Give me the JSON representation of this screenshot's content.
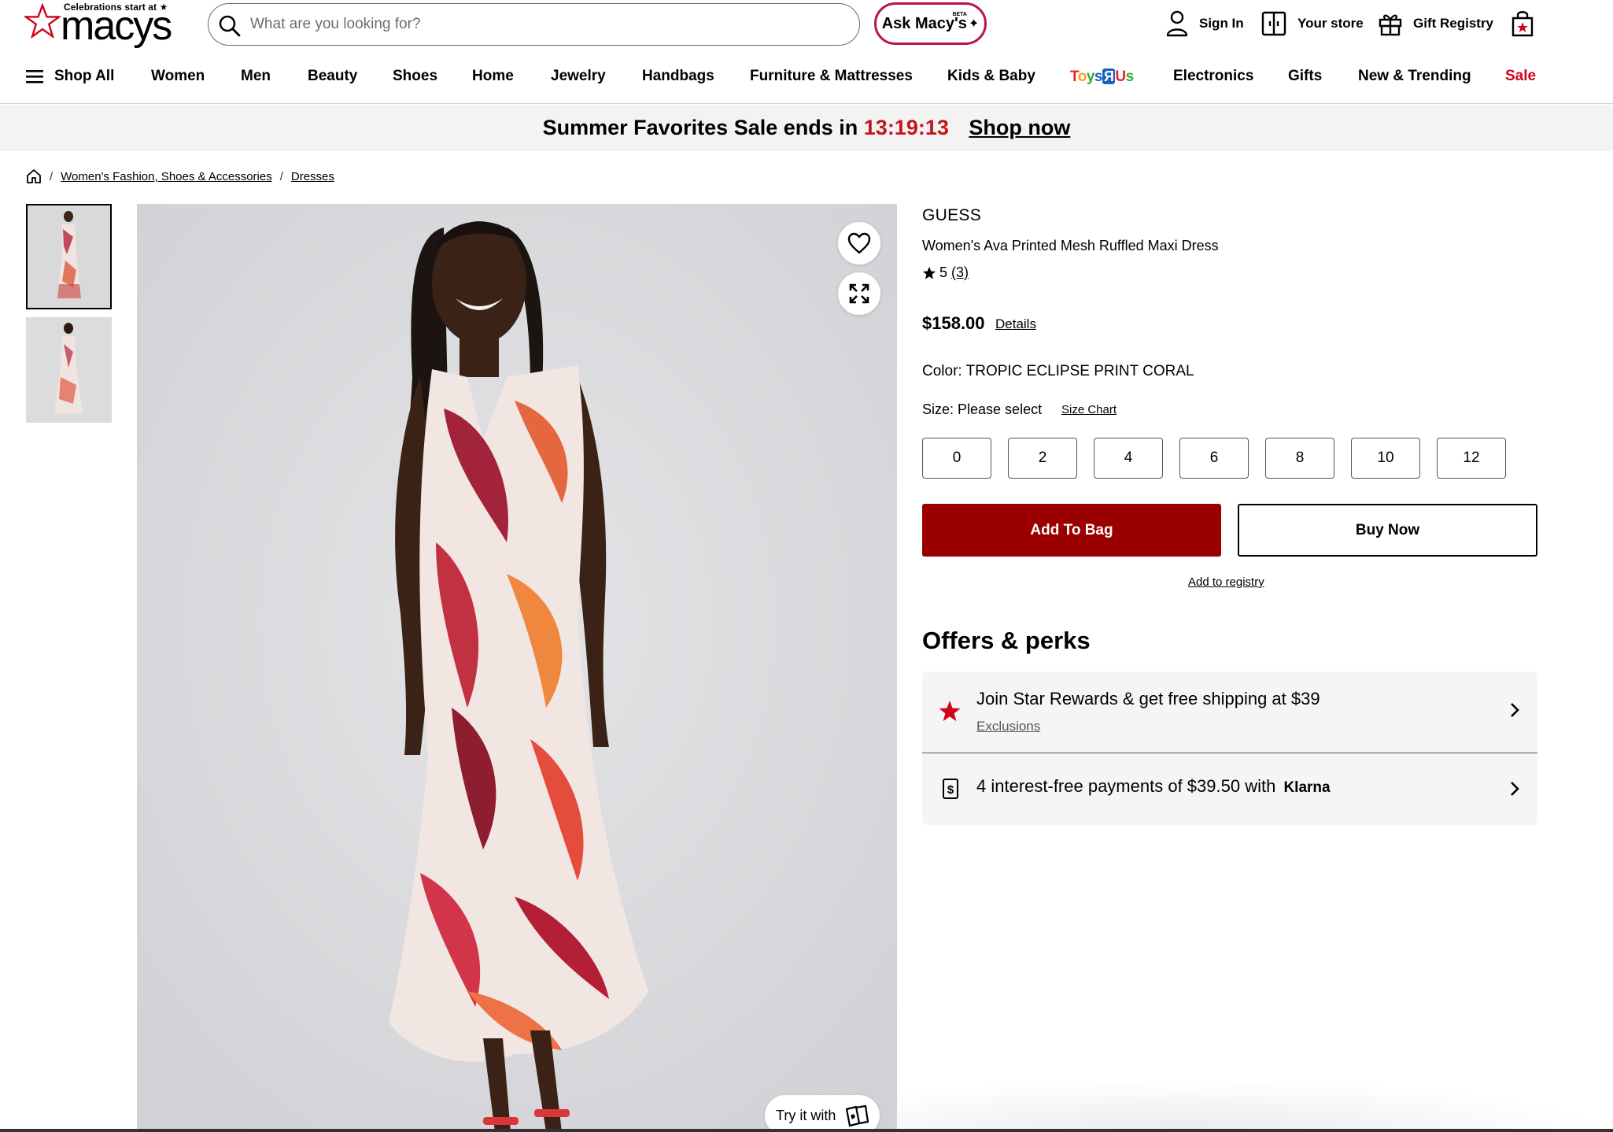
{
  "header": {
    "logo_tagline": "Celebrations start at ★",
    "logo_word": "macys",
    "search_placeholder": "What are you looking for?",
    "ask_label": "Ask Macy's",
    "ask_badge": "BETA",
    "sign_in": "Sign In",
    "your_store": "Your store",
    "gift_registry": "Gift Registry"
  },
  "nav": {
    "shop_all": "Shop All",
    "items": [
      "Women",
      "Men",
      "Beauty",
      "Shoes",
      "Home",
      "Jewelry",
      "Handbags",
      "Furniture & Mattresses",
      "Kids & Baby",
      "Toys R Us",
      "Electronics",
      "Gifts",
      "New & Trending",
      "Sale"
    ]
  },
  "promo": {
    "text": "Summer Favorites Sale ends in",
    "timer": "13:19:13",
    "link": "Shop now"
  },
  "breadcrumb": {
    "items": [
      "Women's Fashion, Shoes & Accessories",
      "Dresses"
    ]
  },
  "product": {
    "brand": "GUESS",
    "name": "Women's Ava Printed Mesh Ruffled Maxi Dress",
    "rating": "5",
    "review_count": "(3)",
    "price": "$158.00",
    "details_link": "Details",
    "color_label": "Color: TROPIC ECLIPSE PRINT CORAL",
    "size_label": "Size: Please select",
    "size_chart": "Size Chart",
    "sizes": [
      "0",
      "2",
      "4",
      "6",
      "8",
      "10",
      "12"
    ],
    "add_to_bag": "Add To Bag",
    "buy_now": "Buy Now",
    "add_to_registry": "Add to registry",
    "try_it_with": "Try it with"
  },
  "offers": {
    "heading": "Offers & perks",
    "star_rewards": "Join Star Rewards & get free shipping at $39",
    "exclusions": "Exclusions",
    "klarna": "4 interest-free payments of $39.50 with",
    "klarna_brand": "Klarna"
  },
  "colors": {
    "brand_red": "#c4141b",
    "add_bag_bg": "#9b0000",
    "ask_border": "#b7154a"
  }
}
